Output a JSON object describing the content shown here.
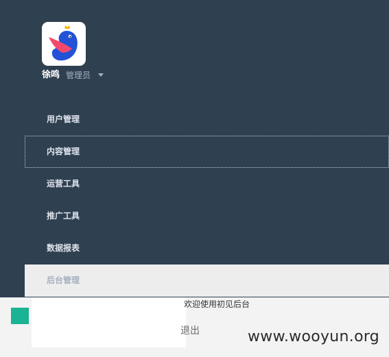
{
  "profile": {
    "name": "徐鸣",
    "role": "管理员"
  },
  "nav": {
    "items": [
      {
        "label": "用户管理"
      },
      {
        "label": "内容管理"
      },
      {
        "label": "运营工具"
      },
      {
        "label": "推广工具"
      },
      {
        "label": "数据报表"
      },
      {
        "label": "后台管理"
      }
    ]
  },
  "content": {
    "welcome": "欢迎使用初见后台",
    "logout_label": "退出"
  },
  "watermark": "www.wooyun.org",
  "colors": {
    "sidebar": "#2f4050",
    "accent": "#1ab394",
    "active_item_bg": "#ededed"
  }
}
